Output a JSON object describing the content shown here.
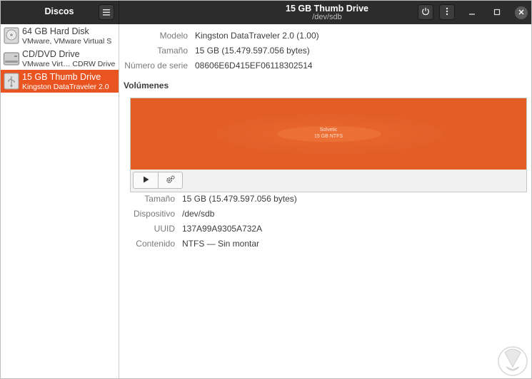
{
  "headerbar": {
    "left_title": "Discos",
    "menu_icon": "hamburger-menu-icon",
    "title": "15 GB Thumb Drive",
    "subtitle": "/dev/sdb",
    "power_icon": "power-icon",
    "more_icon": "vertical-dots-icon",
    "window_controls": [
      "minimize",
      "maximize",
      "close"
    ]
  },
  "sidebar": {
    "items": [
      {
        "name": "64 GB Hard Disk",
        "desc": "VMware, VMware Virtual S",
        "icon": "hard-disk-icon",
        "selected": false
      },
      {
        "name": "CD/DVD Drive",
        "desc": "VMware Virt… CDRW Drive",
        "icon": "optical-drive-icon",
        "selected": false
      },
      {
        "name": "15 GB Thumb Drive",
        "desc": "Kingston DataTraveler 2.0",
        "icon": "usb-drive-icon",
        "selected": true
      }
    ]
  },
  "drive_info": {
    "model_label": "Modelo",
    "model_value": "Kingston DataTraveler 2.0 (1.00)",
    "size_label": "Tamaño",
    "size_value": "15 GB (15.479.597.056 bytes)",
    "serial_label": "Número de serie",
    "serial_value": "08606E6D415EF06118302514"
  },
  "volumes": {
    "title": "Volúmenes",
    "partition_name": "Solvetic",
    "partition_desc": "15 GB NTFS",
    "bar_color": "#e35e25",
    "toolbar": {
      "mount_icon": "play-icon",
      "settings_icon": "gears-icon"
    }
  },
  "volume_info": {
    "size_label": "Tamaño",
    "size_value": "15 GB (15.479.597.056 bytes)",
    "device_label": "Dispositivo",
    "device_value": "/dev/sdb",
    "uuid_label": "UUID",
    "uuid_value": "137A99A9305A732A",
    "content_label": "Contenido",
    "content_value": "NTFS — Sin montar"
  },
  "colors": {
    "accent": "#e95420",
    "headerbar": "#2c2c2c"
  }
}
